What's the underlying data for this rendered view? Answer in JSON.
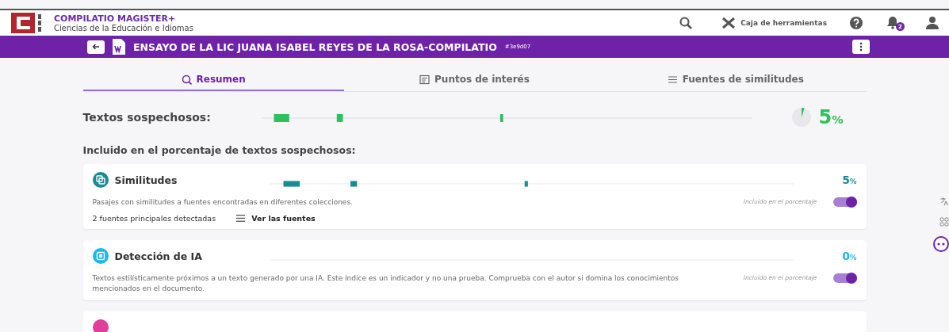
{
  "header": {
    "brand": "COMPILATIO MAGISTER+",
    "subtitle": "Ciencias de la Educación e Idiomas",
    "toolbox": "Caja de herramientas",
    "notifications": "2"
  },
  "document": {
    "title": "ENSAYO DE LA LIC JUANA ISABEL REYES DE LA ROSA-COMPILATIO",
    "code": "#3e9d07"
  },
  "tabs": [
    {
      "label": "Resumen",
      "selected": true
    },
    {
      "label": "Puntos de interés",
      "selected": false
    },
    {
      "label": "Fuentes de similitudes",
      "selected": false
    }
  ],
  "summary": {
    "label": "Textos sospechosos:",
    "value": "5",
    "unit": "%"
  },
  "section_title": "Incluido en el porcentaje de textos sospechosos:",
  "cards": [
    {
      "kind": "similarity",
      "color": "#1a8a93",
      "title": "Similitudes",
      "value": "5",
      "unit": "%",
      "description": "Pasajes con similitudes a fuentes encontradas en diferentes colecciones.",
      "toggle_label": "Incluido en el porcentaje",
      "on": true,
      "sources": "2 fuentes principales detectadas",
      "sources_link": "Ver las fuentes"
    },
    {
      "kind": "ai",
      "color": "#1fb6e8",
      "title": "Detección de IA",
      "value": "0",
      "unit": "%",
      "description": "Textos estilísticamente próximos a un texto generado por una IA. Este índice es un indicador y no una prueba. Comprueba con el autor si domina los conocimientos mencionados en el documento.",
      "toggle_label": "Incluido en el porcentaje",
      "on": true
    },
    {
      "kind": "partial",
      "color": "#e23c9c"
    }
  ]
}
